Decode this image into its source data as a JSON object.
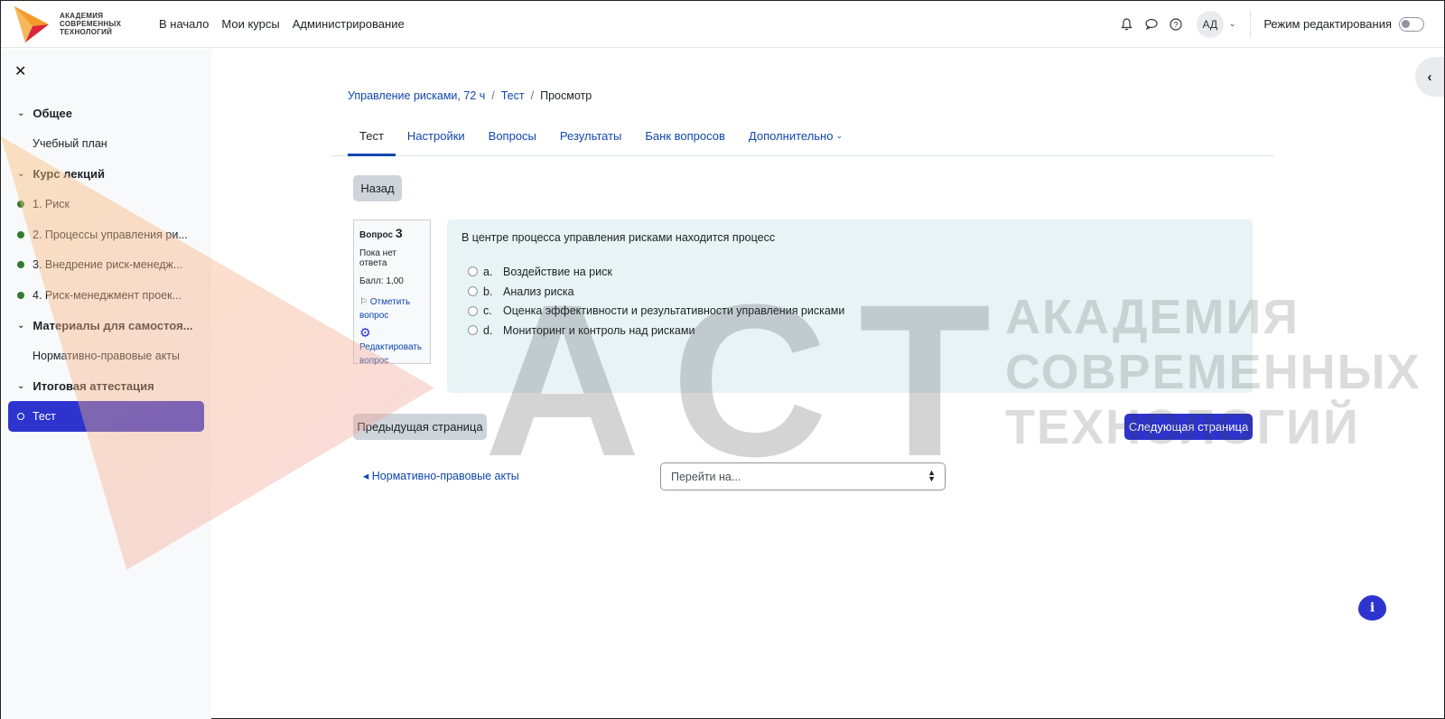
{
  "brand": {
    "name": "АКАДЕМИЯ\nСОВРЕМЕННЫХ\nТЕХНОЛОГИЙ"
  },
  "primary_nav": [
    "В начало",
    "Мои курсы",
    "Администрирование"
  ],
  "user": {
    "initials": "АД"
  },
  "edit_mode": {
    "label": "Режим редактирования",
    "enabled": false
  },
  "drawer": {
    "close_icon": "close-icon",
    "index": [
      {
        "type": "section",
        "label": "Общее"
      },
      {
        "type": "item",
        "label": "Учебный план",
        "status": "none"
      },
      {
        "type": "section",
        "label": "Курс лекций"
      },
      {
        "type": "item",
        "label": "1. Риск",
        "status": "complete"
      },
      {
        "type": "item",
        "label": "2. Процессы управления ри...",
        "status": "complete"
      },
      {
        "type": "item",
        "label": "3. Внедрение риск-менедж...",
        "status": "complete"
      },
      {
        "type": "item",
        "label": "4. Риск-менеджмент проек...",
        "status": "complete"
      },
      {
        "type": "section",
        "label": "Материалы для самостоя..."
      },
      {
        "type": "item",
        "label": "Нормативно-правовые акты",
        "status": "none"
      },
      {
        "type": "section",
        "label": "Итоговая аттестация"
      },
      {
        "type": "item",
        "label": "Тест",
        "status": "active"
      }
    ]
  },
  "breadcrumb": [
    "Управление рисками, 72 ч",
    "Тест",
    "Просмотр"
  ],
  "tabs": [
    "Тест",
    "Настройки",
    "Вопросы",
    "Результаты",
    "Банк вопросов",
    "Дополнительно"
  ],
  "active_tab": "Тест",
  "back_button": "Назад",
  "question": {
    "label": "Вопрос",
    "number": "3",
    "state": "Пока нет ответа",
    "grade": "Балл: 1,00",
    "flag": "Отметить вопрос",
    "edit": "Редактировать вопрос",
    "text": "В центре процесса управления рисками находится процесс",
    "answers": [
      {
        "letter": "a.",
        "text": "Воздействие на риск"
      },
      {
        "letter": "b.",
        "text": "Анализ риска"
      },
      {
        "letter": "c.",
        "text": "Оценка эффективности и результативности управления рисками"
      },
      {
        "letter": "d.",
        "text": "Мониторинг и контроль над рисками"
      }
    ]
  },
  "prev_button": "Предыдущая страница",
  "next_button": "Следующая страница",
  "activity_link": "Нормативно-правовые акты",
  "jump_to": {
    "placeholder": "Перейти на..."
  },
  "watermark": {
    "letters": "АСТ",
    "text": "АКАДЕМИЯ\nСОВРЕМЕННЫХ\nТЕХНОЛОГИЙ"
  },
  "colors": {
    "primary": "#2d34ce",
    "link": "#0f47ad",
    "complete": "#357a32",
    "question_bg": "#e7f3f5"
  }
}
